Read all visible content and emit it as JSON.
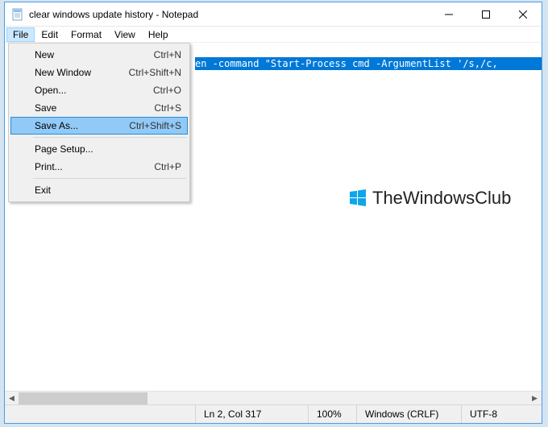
{
  "title": "clear windows update history - Notepad",
  "menu": {
    "file": "File",
    "edit": "Edit",
    "format": "Format",
    "view": "View",
    "help": "Help"
  },
  "file_menu": {
    "new": {
      "label": "New",
      "shortcut": "Ctrl+N"
    },
    "new_window": {
      "label": "New Window",
      "shortcut": "Ctrl+Shift+N"
    },
    "open": {
      "label": "Open...",
      "shortcut": "Ctrl+O"
    },
    "save": {
      "label": "Save",
      "shortcut": "Ctrl+S"
    },
    "save_as": {
      "label": "Save As...",
      "shortcut": "Ctrl+Shift+S"
    },
    "page_setup": {
      "label": "Page Setup...",
      "shortcut": ""
    },
    "print": {
      "label": "Print...",
      "shortcut": "Ctrl+P"
    },
    "exit": {
      "label": "Exit",
      "shortcut": ""
    }
  },
  "editor": {
    "visible_text": "en -command \"Start-Process cmd -ArgumentList '/s,/c,"
  },
  "status": {
    "position": "Ln 2, Col 317",
    "zoom": "100%",
    "line_ending": "Windows (CRLF)",
    "encoding": "UTF-8"
  },
  "watermark": "TheWindowsClub"
}
